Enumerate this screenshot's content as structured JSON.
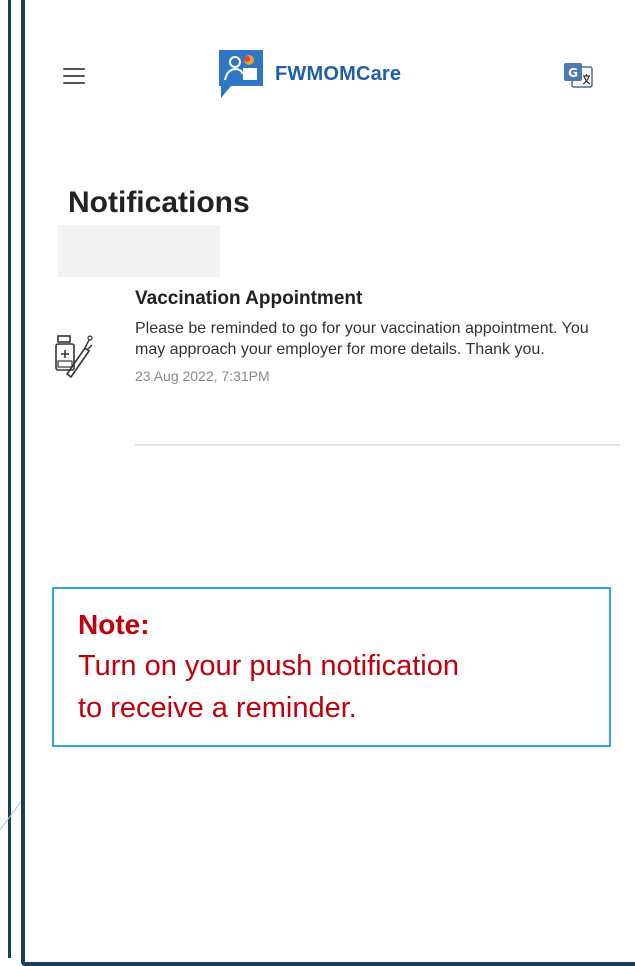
{
  "app": {
    "brand_name": "FWMOMCare"
  },
  "page": {
    "title": "Notifications"
  },
  "notifications": [
    {
      "title": "Vaccination Appointment",
      "message": "Please be reminded to go for your vaccination appointment. You may approach your employer for more details. Thank you.",
      "timestamp": "23 Aug 2022, 7:31PM",
      "icon": "vaccine-icon"
    }
  ],
  "note": {
    "label": "Note:",
    "text_line1": "Turn on your push notification",
    "text_line2": "to receive a reminder."
  },
  "colors": {
    "brand": "#1f5fa8",
    "frame": "#1a3d5c",
    "note_text": "#c0000c",
    "note_border": "#2ea7d8"
  }
}
